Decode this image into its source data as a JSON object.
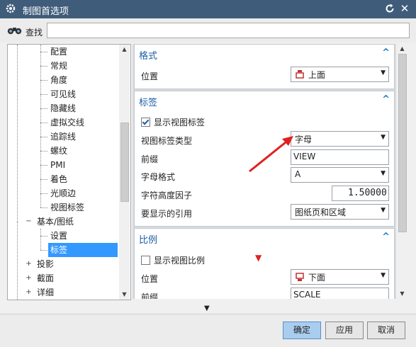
{
  "window": {
    "title": "制图首选项",
    "close_glyph": "✕"
  },
  "find": {
    "label": "查找",
    "value": ""
  },
  "tree": {
    "items": [
      {
        "label": "配置"
      },
      {
        "label": "常规"
      },
      {
        "label": "角度"
      },
      {
        "label": "可见线"
      },
      {
        "label": "隐藏线"
      },
      {
        "label": "虚拟交线"
      },
      {
        "label": "追踪线"
      },
      {
        "label": "螺纹"
      },
      {
        "label": "PMI"
      },
      {
        "label": "着色"
      },
      {
        "label": "光顺边"
      },
      {
        "label": "视图标签"
      }
    ],
    "group": {
      "label": "基本/图纸",
      "expander": "−"
    },
    "group_children": [
      {
        "label": "设置"
      },
      {
        "label": "标签"
      }
    ],
    "bottom_items": [
      {
        "label": "投影",
        "expander": "+"
      },
      {
        "label": "截面",
        "expander": "+"
      },
      {
        "label": "详细",
        "expander": "+"
      }
    ]
  },
  "sections": {
    "format": {
      "title": "格式",
      "collapse": "^",
      "position_label": "位置",
      "position_value": "上面"
    },
    "label": {
      "title": "标签",
      "collapse": "^",
      "show_label": "显示视图标签",
      "show_label_checked": true,
      "type_label": "视图标签类型",
      "type_value": "字母",
      "prefix_label": "前缀",
      "prefix_value": "VIEW",
      "letter_format_label": "字母格式",
      "letter_format_value": "A",
      "char_height_label": "字符高度因子",
      "char_height_value": "1.50000",
      "reference_label": "要显示的引用",
      "reference_value": "图纸页和区域"
    },
    "scale": {
      "title": "比例",
      "collapse": "^",
      "show_scale": "显示视图比例",
      "show_scale_checked": false,
      "position_label": "位置",
      "position_value": "下面",
      "prefix_label": "前缀",
      "prefix_value": "SCALE"
    }
  },
  "buttons": {
    "ok": "确定",
    "apply": "应用",
    "cancel": "取消"
  },
  "colors": {
    "titlebar": "#3f5d7a",
    "accent": "#1a5ea8",
    "selection": "#3399ff",
    "arrow": "#e02020"
  }
}
